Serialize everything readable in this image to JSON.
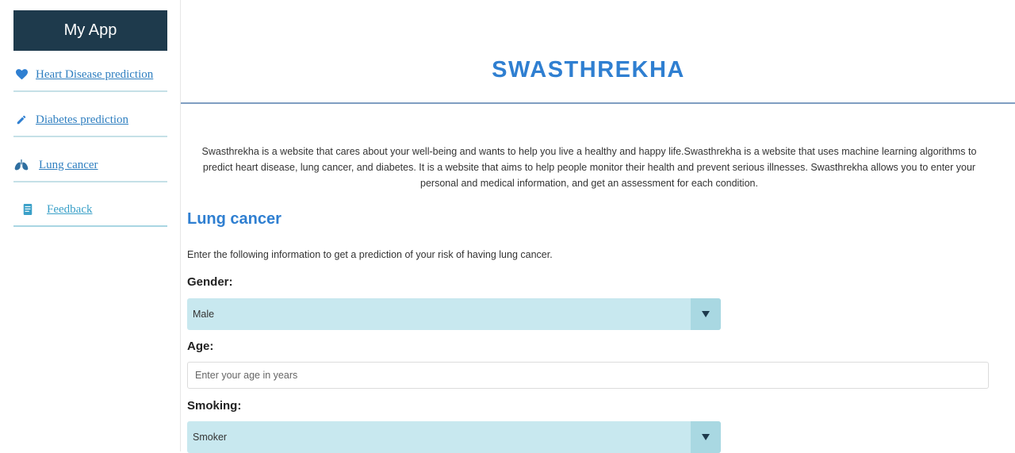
{
  "sidebar": {
    "app_title": "My App",
    "items": [
      {
        "label": "Heart Disease prediction",
        "icon": "heart-icon"
      },
      {
        "label": "Diabetes prediction",
        "icon": "pencil-icon"
      },
      {
        "label": "Lung cancer",
        "icon": "lungs-icon"
      },
      {
        "label": "Feedback",
        "icon": "book-icon"
      }
    ]
  },
  "main": {
    "site_title": "SWASTHREKHA",
    "intro": "Swasthrekha is a website that cares about your well-being and wants to help you live a healthy and happy life.Swasthrekha is a website that uses machine learning algorithms to predict heart disease, lung cancer, and diabetes. It is a website that aims to help people monitor their health and prevent serious illnesses. Swasthrekha allows you to enter your personal and medical information, and get an assessment for each condition.",
    "section_heading": "Lung cancer",
    "section_description": "Enter the following information to get a prediction of your risk of having lung cancer.",
    "form": {
      "gender": {
        "label": "Gender:",
        "value": "Male"
      },
      "age": {
        "label": "Age:",
        "placeholder": "Enter your age in years",
        "value": ""
      },
      "smoking": {
        "label": "Smoking:",
        "value": "Smoker"
      }
    }
  },
  "colors": {
    "sidebar_header_bg": "#1e3a4c",
    "accent_blue": "#2f7fd1",
    "link_blue": "#2f7fc0",
    "select_bg": "#c8e8ef",
    "nav_underline": "#c5e0e7"
  }
}
